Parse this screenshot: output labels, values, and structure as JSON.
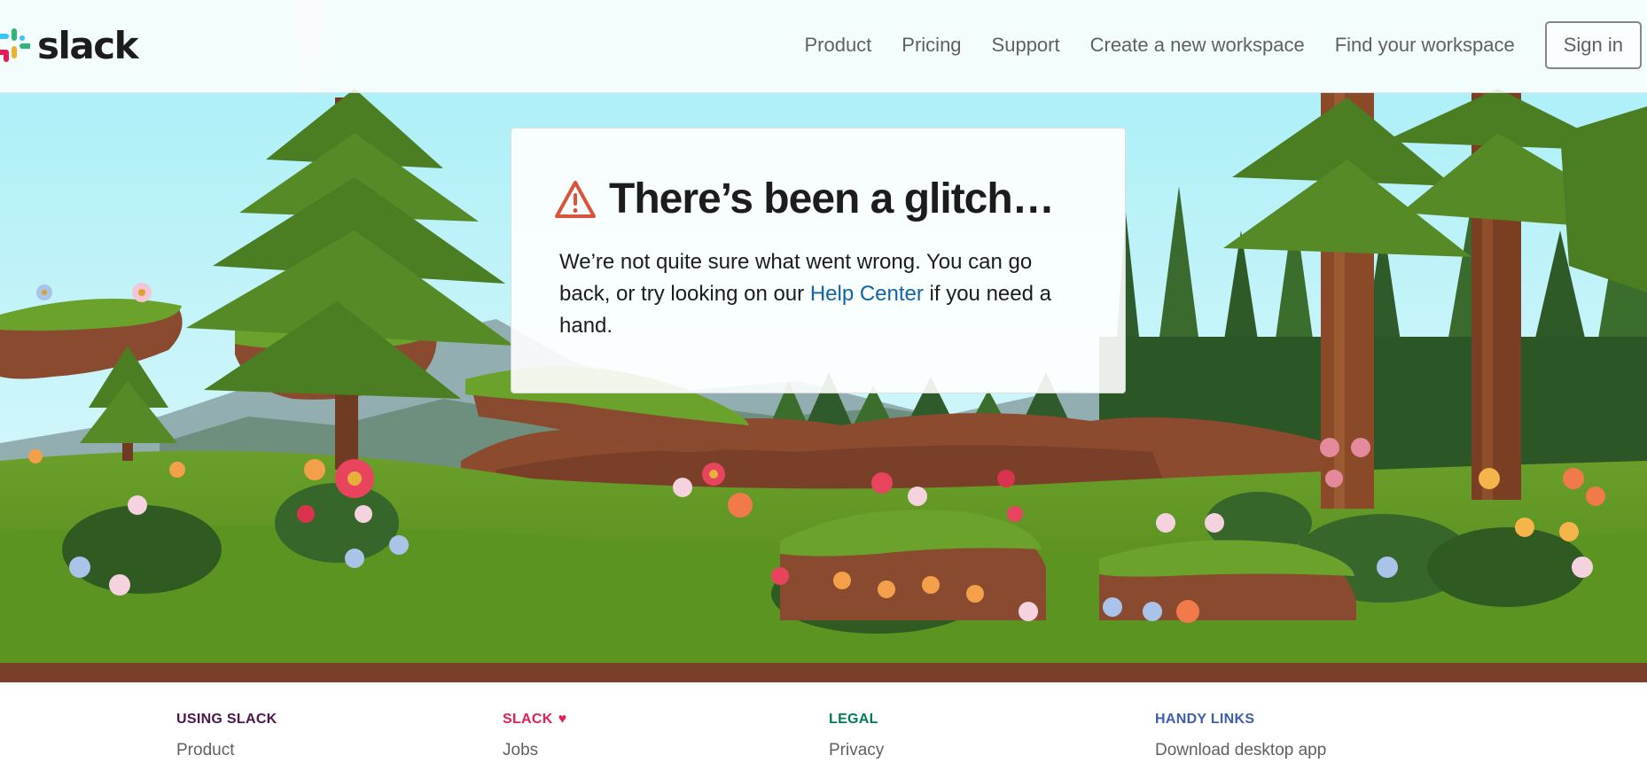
{
  "header": {
    "logo_text": "slack",
    "nav": {
      "product": "Product",
      "pricing": "Pricing",
      "support": "Support",
      "create_workspace": "Create a new workspace",
      "find_workspace": "Find your workspace"
    },
    "sign_in": "Sign in"
  },
  "error_card": {
    "icon": "warning-triangle-icon",
    "title": "There’s been a glitch…",
    "body_before_link": "We’re not quite sure what went wrong. You can go back, or try looking on our ",
    "link_text": "Help Center",
    "body_after_link": " if you need a hand."
  },
  "footer": {
    "columns": [
      {
        "heading": "USING SLACK",
        "color": "#4a154b",
        "first_link": "Product"
      },
      {
        "heading": "SLACK",
        "color": "#e01e5a",
        "icon": "heart-icon",
        "first_link": "Jobs"
      },
      {
        "heading": "LEGAL",
        "color": "#007a5a",
        "first_link": "Privacy"
      },
      {
        "heading": "HANDY LINKS",
        "color": "#3e5dab",
        "first_link": "Download desktop app"
      }
    ]
  },
  "colors": {
    "accent_warning": "#d9553a",
    "link": "#1264a3",
    "sky": "#bdeef5",
    "grass": "#5a8e21",
    "soil": "#8a4a30"
  }
}
